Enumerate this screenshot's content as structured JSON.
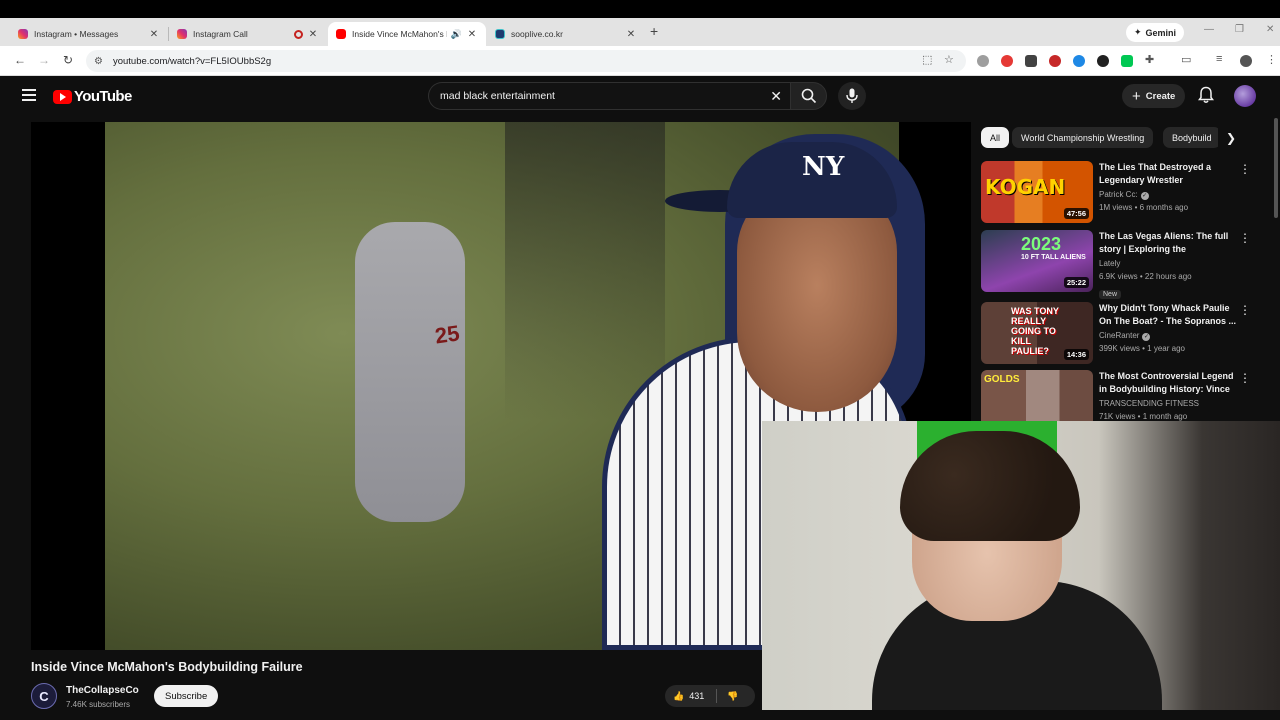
{
  "browser": {
    "tabs": [
      {
        "label": "Instagram • Messages",
        "favicon": "instagram-icon"
      },
      {
        "label": "Instagram Call",
        "favicon": "instagram-icon"
      },
      {
        "label": "Inside Vince McMahon's Bo",
        "favicon": "youtube-icon"
      },
      {
        "label": "sooplive.co.kr",
        "favicon": "soop-icon"
      }
    ],
    "gemini_label": "Gemini",
    "url": "youtube.com/watch?v=FL5IOUbbS2g"
  },
  "youtube": {
    "logo_text": "YouTube",
    "search_value": "mad black entertainment",
    "create_label": "Create"
  },
  "chips": [
    "All",
    "World Championship Wrestling",
    "Bodybuild"
  ],
  "video": {
    "title": "Inside Vince McMahon's Bodybuilding Failure",
    "channel": "TheCollapseCo",
    "channel_initial": "C",
    "subscribers": "7.46K subscribers",
    "subscribe_label": "Subscribe",
    "likes": "431"
  },
  "recommendations": [
    {
      "title": "The Lies That Destroyed a Legendary Wrestler",
      "channel": "Patrick Cc:",
      "verified": true,
      "stats": "1M views • 6 months ago",
      "duration": "47:56",
      "thumb_text": "KOGAN",
      "is_new": false
    },
    {
      "title": "The Las Vegas Aliens: The full story | Exploring the Paranormal",
      "channel": "Lately",
      "verified": false,
      "stats": "6.9K views • 22 hours ago",
      "duration": "25:22",
      "thumb_text": "2023",
      "thumb_sub": "10 FT TALL ALIENS",
      "is_new": true,
      "new_label": "New"
    },
    {
      "title": "Why Didn't Tony Whack Paulie On The Boat? - The Sopranos ...",
      "channel": "CineRanter",
      "verified": true,
      "stats": "399K views • 1 year ago",
      "duration": "14:36",
      "thumb_text": "WAS TONY REALLY GOING TO KILL PAULIE?",
      "is_new": false
    },
    {
      "title": "The Most Controversial Legend in Bodybuilding History: Vince ...",
      "channel": "TRANSCENDING FITNESS",
      "verified": false,
      "stats": "71K views • 1 month ago",
      "duration": "",
      "thumb_text": "GOLDS",
      "is_new": false
    }
  ],
  "colors": {
    "youtube_red": "#ff0000",
    "background": "#0f0f0f",
    "chip_bg": "#272727"
  }
}
